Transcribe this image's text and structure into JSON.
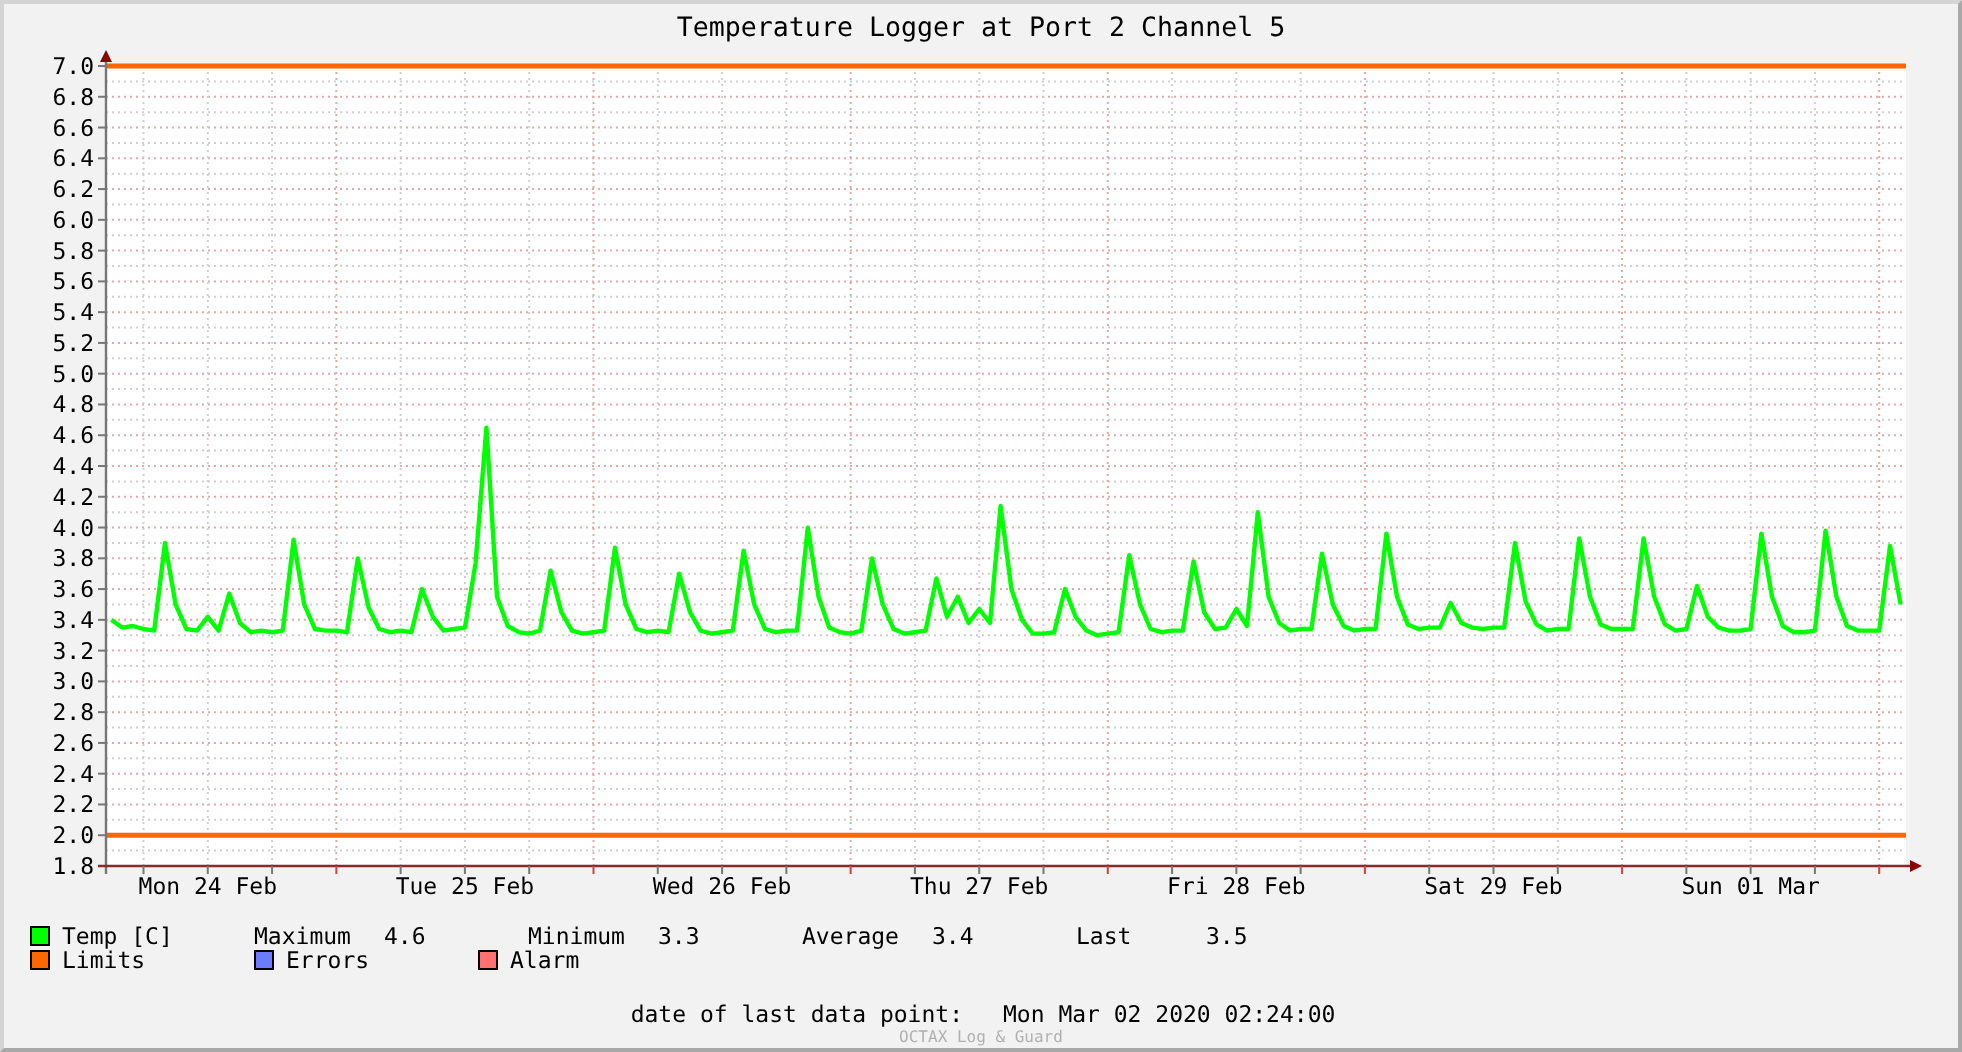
{
  "title": "Temperature Logger at Port 2 Channel 5",
  "chart": {
    "chart_data": {
      "type": "line",
      "categories": [
        null,
        null,
        null,
        null,
        null,
        null,
        null,
        null,
        null,
        "Mon 24 Feb",
        null,
        null,
        null,
        null,
        null,
        null,
        null,
        null,
        null,
        null,
        null,
        null,
        null,
        null,
        null,
        null,
        null,
        null,
        null,
        null,
        null,
        null,
        null,
        "Tue 25 Feb",
        null,
        null,
        null,
        null,
        null,
        null,
        null,
        null,
        null,
        null,
        null,
        null,
        null,
        null,
        null,
        null,
        null,
        null,
        null,
        null,
        null,
        null,
        null,
        "Wed 26 Feb",
        null,
        null,
        null,
        null,
        null,
        null,
        null,
        null,
        null,
        null,
        null,
        null,
        null,
        null,
        null,
        null,
        null,
        null,
        null,
        null,
        null,
        null,
        null,
        "Thu 27 Feb",
        null,
        null,
        null,
        null,
        null,
        null,
        null,
        null,
        null,
        null,
        null,
        null,
        null,
        null,
        null,
        null,
        null,
        null,
        null,
        null,
        null,
        null,
        null,
        "Fri 28 Feb",
        null,
        null,
        null,
        null,
        null,
        null,
        null,
        null,
        null,
        null,
        null,
        null,
        null,
        null,
        null,
        null,
        null,
        null,
        null,
        null,
        null,
        null,
        null,
        "Sat 29 Feb",
        null,
        null,
        null,
        null,
        null,
        null,
        null,
        null,
        null,
        null,
        null,
        null,
        null,
        null,
        null,
        null,
        null,
        null,
        null,
        null,
        null,
        null,
        null,
        "Sun 01 Mar",
        null,
        null,
        null,
        null,
        null,
        null,
        null,
        null,
        null,
        null,
        null,
        null,
        null,
        null
      ],
      "series": [
        {
          "name": "Temp [C]",
          "color": "#00ff00",
          "values": [
            3.4,
            3.35,
            3.36,
            3.34,
            3.33,
            3.9,
            3.5,
            3.34,
            3.33,
            3.42,
            3.33,
            3.57,
            3.38,
            3.32,
            3.33,
            3.32,
            3.33,
            3.92,
            3.5,
            3.34,
            3.33,
            3.33,
            3.32,
            3.8,
            3.48,
            3.34,
            3.32,
            3.33,
            3.32,
            3.6,
            3.42,
            3.33,
            3.34,
            3.35,
            3.77,
            4.65,
            3.55,
            3.36,
            3.32,
            3.31,
            3.33,
            3.72,
            3.45,
            3.33,
            3.31,
            3.32,
            3.33,
            3.87,
            3.5,
            3.34,
            3.32,
            3.33,
            3.32,
            3.7,
            3.45,
            3.33,
            3.31,
            3.32,
            3.33,
            3.85,
            3.5,
            3.34,
            3.32,
            3.33,
            3.33,
            4.0,
            3.55,
            3.35,
            3.32,
            3.31,
            3.33,
            3.8,
            3.5,
            3.34,
            3.31,
            3.32,
            3.33,
            3.67,
            3.42,
            3.55,
            3.38,
            3.47,
            3.38,
            4.14,
            3.6,
            3.4,
            3.31,
            3.31,
            3.32,
            3.6,
            3.42,
            3.33,
            3.3,
            3.31,
            3.32,
            3.82,
            3.5,
            3.34,
            3.32,
            3.33,
            3.33,
            3.78,
            3.45,
            3.34,
            3.35,
            3.47,
            3.36,
            4.1,
            3.55,
            3.38,
            3.33,
            3.34,
            3.34,
            3.83,
            3.5,
            3.36,
            3.33,
            3.34,
            3.34,
            3.96,
            3.55,
            3.37,
            3.34,
            3.35,
            3.35,
            3.51,
            3.38,
            3.35,
            3.34,
            3.35,
            3.35,
            3.9,
            3.52,
            3.37,
            3.33,
            3.34,
            3.34,
            3.93,
            3.55,
            3.37,
            3.34,
            3.34,
            3.34,
            3.93,
            3.55,
            3.37,
            3.33,
            3.34,
            3.62,
            3.42,
            3.35,
            3.33,
            3.33,
            3.34,
            3.96,
            3.55,
            3.36,
            3.32,
            3.32,
            3.33,
            3.98,
            3.55,
            3.36,
            3.33,
            3.33,
            3.33,
            3.88,
            3.5
          ]
        }
      ],
      "grid": true,
      "ylim": [
        1.8,
        7.0
      ],
      "yticks": [
        {
          "value": 1.8,
          "label": "1.8"
        },
        {
          "value": 2.0,
          "label": "2.0"
        },
        {
          "value": 2.2,
          "label": "2.2"
        },
        {
          "value": 2.4,
          "label": "2.4"
        },
        {
          "value": 2.6,
          "label": "2.6"
        },
        {
          "value": 2.8,
          "label": "2.8"
        },
        {
          "value": 3.0,
          "label": "3.0"
        },
        {
          "value": 3.2,
          "label": "3.2"
        },
        {
          "value": 3.4,
          "label": "3.4"
        },
        {
          "value": 3.6,
          "label": "3.6"
        },
        {
          "value": 3.8,
          "label": "3.8"
        },
        {
          "value": 4.0,
          "label": "4.0"
        },
        {
          "value": 4.2,
          "label": "4.2"
        },
        {
          "value": 4.4,
          "label": "4.4"
        },
        {
          "value": 4.6,
          "label": "4.6"
        },
        {
          "value": 4.8,
          "label": "4.8"
        },
        {
          "value": 5.0,
          "label": "5.0"
        },
        {
          "value": 5.2,
          "label": "5.2"
        },
        {
          "value": 5.4,
          "label": "5.4"
        },
        {
          "value": 5.6,
          "label": "5.6"
        },
        {
          "value": 5.8,
          "label": "5.8"
        },
        {
          "value": 6.0,
          "label": "6.0"
        },
        {
          "value": 6.2,
          "label": "6.2"
        },
        {
          "value": 6.4,
          "label": "6.4"
        },
        {
          "value": 6.6,
          "label": "6.6"
        },
        {
          "value": 6.8,
          "label": "6.8"
        },
        {
          "value": 7.0,
          "label": "7.0"
        }
      ],
      "ref_lines": [
        {
          "axis": "y",
          "value": 7.0,
          "color": "#ff6600"
        },
        {
          "axis": "y",
          "value": 2.0,
          "color": "#ff6600"
        }
      ]
    }
  },
  "legend": [
    {
      "items": [
        {
          "kind": "series"
        },
        {
          "kind": "stat",
          "label": "Maximum",
          "value": "4.6"
        },
        {
          "kind": "stat",
          "label": "Minimum",
          "value": "3.3"
        },
        {
          "kind": "stat",
          "label": "Average",
          "value": "3.4"
        },
        {
          "kind": "stat",
          "label": "Last",
          "value": "3.5"
        }
      ]
    },
    {
      "items": [
        {
          "kind": "swatch",
          "label": "Limits",
          "color": "#ff6600"
        },
        {
          "kind": "swatch",
          "label": "Errors",
          "color": "#6c7cff"
        },
        {
          "kind": "swatch",
          "label": "Alarm",
          "color": "#ff7070"
        }
      ]
    }
  ],
  "footer": {
    "label": "date of last data point:",
    "value": "Mon Mar 02 2020 02:24:00",
    "credit": "OCTAX Log & Guard"
  }
}
